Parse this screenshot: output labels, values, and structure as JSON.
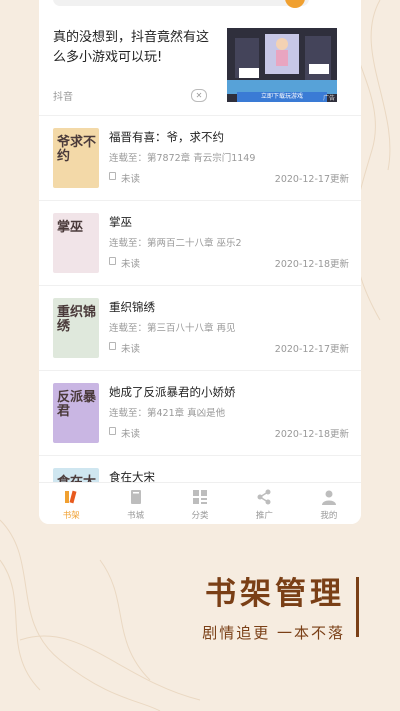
{
  "ad": {
    "text": "真的没想到，抖音竟然有这么多小游戏可以玩!",
    "source": "抖音",
    "close_icon": "✕",
    "image_caption": "立即下载玩游戏",
    "image_tag": "广告"
  },
  "books": [
    {
      "title": "福晋有喜：爷，求不约",
      "progress": "连载至：第7872章 青云宗门1149",
      "status": "未读",
      "date": "2020-12-17更新",
      "cover_text": "爷求不约",
      "cover_color": "#f3d9a8"
    },
    {
      "title": "掌巫",
      "progress": "连载至：第两百二十八章 巫乐2",
      "status": "未读",
      "date": "2020-12-18更新",
      "cover_text": "掌巫",
      "cover_color": "#f1e4e8"
    },
    {
      "title": "重织锦绣",
      "progress": "连载至：第三百八十八章 再见",
      "status": "未读",
      "date": "2020-12-17更新",
      "cover_text": "重织锦绣",
      "cover_color": "#dfe8dc"
    },
    {
      "title": "她成了反派暴君的小娇娇",
      "progress": "连载至：第421章 真凶是他",
      "status": "未读",
      "date": "2020-12-18更新",
      "cover_text": "反派暴君",
      "cover_color": "#c9b6e3"
    },
    {
      "title": "食在大宋",
      "progress": "",
      "status": "",
      "date": "",
      "cover_text": "食在大宋",
      "cover_color": "#cfe6f0"
    }
  ],
  "tabbar": [
    {
      "label": "书架",
      "icon": "bookshelf-icon",
      "active": true
    },
    {
      "label": "书城",
      "icon": "book-icon",
      "active": false
    },
    {
      "label": "分类",
      "icon": "category-icon",
      "active": false
    },
    {
      "label": "推广",
      "icon": "share-icon",
      "active": false
    },
    {
      "label": "我的",
      "icon": "user-icon",
      "active": false
    }
  ],
  "slogan": {
    "title": "书架管理",
    "subtitle": "剧情追更 一本不落"
  },
  "colors": {
    "accent": "#f0a030",
    "brand_brown": "#7a3f16",
    "background": "#f6ece0"
  }
}
